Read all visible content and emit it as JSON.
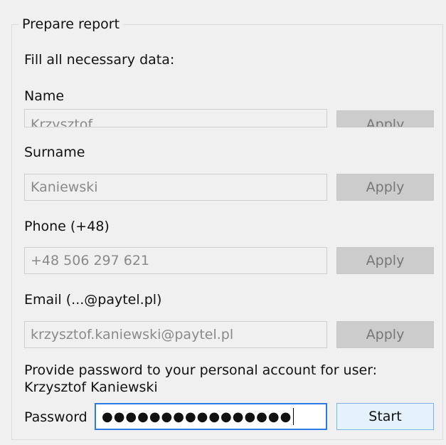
{
  "group": {
    "title": "Prepare report",
    "instruction": "Fill all necessary data:"
  },
  "fields": {
    "name": {
      "label": "Name",
      "value": "Krzysztof",
      "button": "Apply"
    },
    "surname": {
      "label": "Surname",
      "value": "Kaniewski",
      "button": "Apply"
    },
    "phone": {
      "label": "Phone (+48)",
      "value": "+48 506 297 621",
      "button": "Apply"
    },
    "email": {
      "label": "Email (...@paytel.pl)",
      "value": "krzysztof.kaniewski@paytel.pl",
      "button": "Apply"
    }
  },
  "password": {
    "hint": "Provide password to your personal account for user: Krzysztof Kaniewski",
    "label": "Password",
    "masked_value": "●●●●●●●●●●●●●●●●",
    "button": "Start"
  },
  "colors": {
    "focus_border": "#2c7be5",
    "start_button_border": "#7eb4ea",
    "start_button_background": "#e5f1fb"
  }
}
